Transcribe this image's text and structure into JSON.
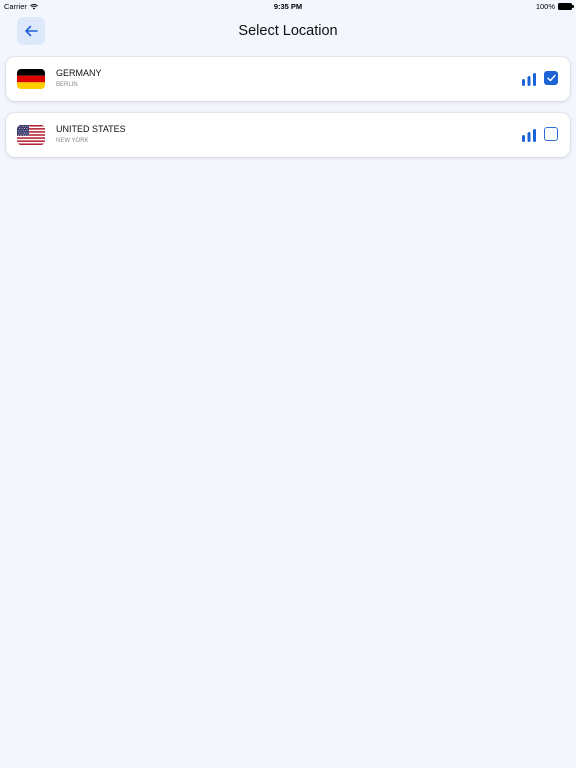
{
  "status_bar": {
    "carrier": "Carrier",
    "time": "9:35 PM",
    "battery": "100%"
  },
  "header": {
    "title": "Select Location",
    "back_icon": "arrow-left-icon"
  },
  "locations": [
    {
      "country": "GERMANY",
      "city": "BERLIN",
      "flag": "germany-flag",
      "selected": true
    },
    {
      "country": "UNITED STATES",
      "city": "NEW YORK",
      "flag": "usa-flag",
      "selected": false
    }
  ],
  "colors": {
    "accent": "#1e63d6",
    "background": "#f3f7fd",
    "back_button_bg": "#dde9fb"
  }
}
